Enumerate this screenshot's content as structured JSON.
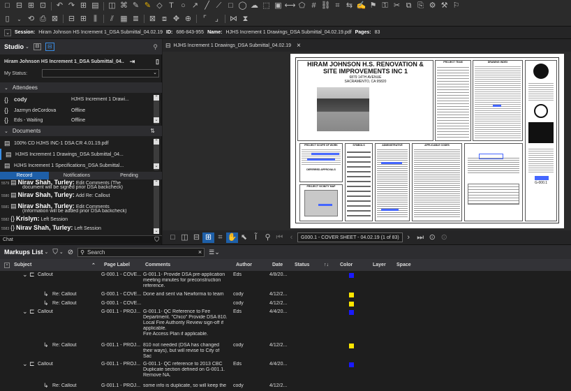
{
  "session": {
    "session_label": "Session:",
    "session_value": "Hiram Johnson HS Increment 1_DSA Submittal_04.02.19",
    "id_label": "ID:",
    "id_value": "686-843-955",
    "name_label": "Name:",
    "name_value": "HJHS Increment 1 Drawings_DSA Submittal_04.02.19.pdf",
    "pages_label": "Pages:",
    "pages_value": "83"
  },
  "studio": {
    "title": "Studio",
    "project_name": "Hiram Johnson HS Increment 1_DSA Submittal_04..",
    "my_status_label": "My Status:",
    "attendees_label": "Attendees",
    "attendees": [
      {
        "name": "cody",
        "status": "HJHS Increment 1 Drawi..."
      },
      {
        "name": "Jazmyn deCordova",
        "status": "Offline"
      },
      {
        "name": "Eds - Waiting",
        "status": "Offline"
      }
    ],
    "documents_label": "Documents",
    "documents": [
      "100% CD HJHS INC-1 DSA CR 4.01.19.pdf",
      "HJHS Increment 1 Drawings_DSA Submittal_04...",
      "HJHS Increment 1 Specifications_DSA Submittal..."
    ],
    "tabs": [
      "Record",
      "Notifications",
      "Pending"
    ],
    "records": [
      {
        "num": "5579",
        "author": "Nirav Shah, Turley:",
        "action": "Edit Comments (The",
        "detail": "document will be signed prior DSA backcheck)"
      },
      {
        "num": "5580",
        "author": "Nirav Shah, Turley:",
        "action": "Add Re: Callout",
        "detail": ""
      },
      {
        "num": "5581",
        "author": "Nirav Shah, Turley:",
        "action": "Edit Comments",
        "detail": "(Information will be added prior DSA backcheck)"
      },
      {
        "num": "5582",
        "author": "Krislyn:",
        "action": "Left Session",
        "detail": ""
      },
      {
        "num": "5583",
        "author": "Nirav Shah, Turley:",
        "action": "Left Session",
        "detail": ""
      }
    ],
    "chat_placeholder": "Chat"
  },
  "viewer": {
    "tab_title": "HJHS Increment 1 Drawings_DSA Submittal_04.02.19",
    "page_select": "G000.1 - COVER SHEET - 04.02.19 (1 of 83)",
    "sheet": {
      "title_line1": "HIRAM JOHNSON H.S. RENOVATION &",
      "title_line2": "SITE IMPROVEMENTS INC 1",
      "address1": "6879 14TH AVENUE",
      "address2": "SACRAMENTO, CA 95820",
      "project_team": "PROJECT TEAM",
      "drawing_index": "DRAWING INDEX",
      "scope": "PROJECT SCOPE OF WORK",
      "symbols": "SYMBOLS",
      "administrative": "ADMINISTRATIVE",
      "deferred": "DEFERRED APPROVALS",
      "vicinity": "PROJECT VICINITY MAP",
      "codes": "APPLICABLE CODES",
      "sheet_number": "G-000.1"
    }
  },
  "markups": {
    "title": "Markups List",
    "search_placeholder": "Search",
    "columns": [
      "Subject",
      "Page Label",
      "Comments",
      "Author",
      "Date",
      "Status",
      "Color",
      "Layer",
      "Space"
    ],
    "rows": [
      {
        "subject": "Callout",
        "reply": false,
        "page": "G-000.1 - COVE...",
        "comments": [
          "G-001.1- Provide DSA pre-application",
          "meeting minutes for preconstruction",
          "reference."
        ],
        "author": "Eds",
        "date": "4/8/20...",
        "color": "#1a1aff"
      },
      {
        "subject": "Re: Callout",
        "reply": true,
        "page": "G-000.1 - COVE...",
        "comments": [
          "Done and sent via Newforma to team"
        ],
        "author": "cody",
        "date": "4/12/2...",
        "color": "#ffe600"
      },
      {
        "subject": "Re: Callout",
        "reply": true,
        "page": "G-000.1 - COVE...",
        "comments": [
          ""
        ],
        "author": "cody",
        "date": "4/12/2...",
        "color": "#ffe600"
      },
      {
        "subject": "Callout",
        "reply": false,
        "page": "G-001.1 - PROJ...",
        "comments": [
          "G-001.1- QC Reference to Fire",
          "Department. \"Chico\" Provide DSA 810.",
          "Local Fire Authority Review sign-off if",
          "applicable.",
          "Fire Access Plan if applicable."
        ],
        "author": "Eds",
        "date": "4/4/20...",
        "color": "#1a1aff"
      },
      {
        "subject": "Re: Callout",
        "reply": true,
        "page": "G-001.1 - PROJ...",
        "comments": [
          "810 not needed (DSA has changed",
          "their ways), but will revise to City of",
          "Sac"
        ],
        "author": "cody",
        "date": "4/12/2...",
        "color": "#ffe600"
      },
      {
        "subject": "Callout",
        "reply": false,
        "page": "G-001.1 - PROJ...",
        "comments": [
          "G-001.1- QC reference to 2013 CBC",
          "Duplicate section defined on G-001.1.",
          "Remove NA."
        ],
        "author": "Eds",
        "date": "4/4/20...",
        "color": "#1a1aff"
      },
      {
        "subject": "Re: Callout",
        "reply": true,
        "page": "G-001.1 - PROJ...",
        "comments": [
          "some info is duplicate, so will keep the"
        ],
        "author": "cody",
        "date": "4/12/2...",
        "color": ""
      }
    ]
  }
}
